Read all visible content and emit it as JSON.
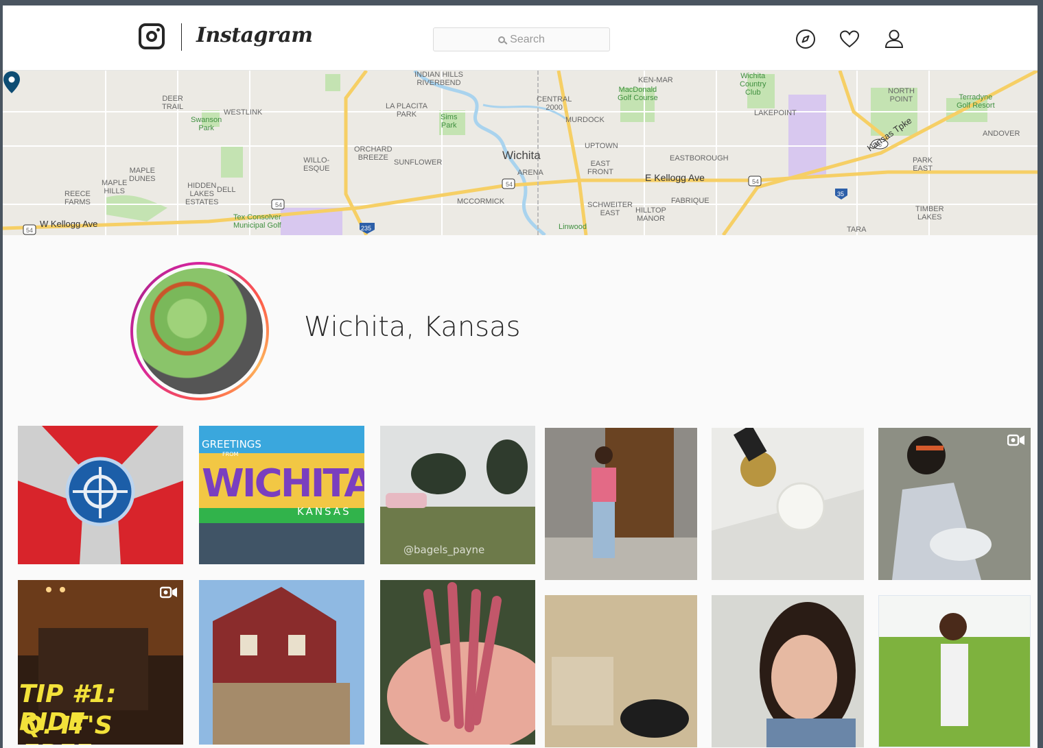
{
  "header": {
    "wordmark": "Instagram",
    "search_placeholder": "Search"
  },
  "map": {
    "city_label": "Wichita",
    "road_east": "E Kellogg Ave",
    "road_west": "W Kellogg Ave",
    "turnpike": "Kansas Tpke",
    "labels": {
      "riverbend": "INDIAN HILLS\nRIVERBEND",
      "deer_trail": "DEER\nTRAIL",
      "westlink": "WESTLINK",
      "swanson": "Swanson\nPark",
      "la_placita": "LA PLACITA\nPARK",
      "sims": "Sims\nPark",
      "central": "CENTRAL\n2000",
      "murdock": "MURDOCK",
      "ken_mar": "KEN-MAR",
      "macdonald": "MacDonald\nGolf Course",
      "wichita_cc": "Wichita\nCountry\nClub",
      "lakepoint": "LAKEPOINT",
      "north_point": "NORTH\nPOINT",
      "terradyne": "Terradyne\nGolf Resort",
      "andover": "ANDOVER",
      "orchard": "ORCHARD\nBREEZE",
      "sunflower": "SUNFLOWER",
      "uptown": "UPTOWN",
      "eastborough": "EASTBOROUGH",
      "willo": "WILLO-\nESQUE",
      "maple_dunes": "MAPLE\nDUNES",
      "maple_hills": "MAPLE\nHILLS",
      "reece": "REECE\nFARMS",
      "hidden_lakes": "HIDDEN\nLAKES\nESTATES",
      "dell": "DELL",
      "arena": "ARENA",
      "east_front": "EAST\nFRONT",
      "park_east": "PARK\nEAST",
      "mccormick": "MCCORMICK",
      "schweiter": "SCHWEITER\nEAST",
      "hilltop": "HILLTOP\nMANOR",
      "fabrique": "FABRIQUE",
      "timber": "TIMBER\nLAKES",
      "tara": "TARA",
      "linwood": "Linwood",
      "tex": "Tex Consolver\nMunicipal Golf",
      "shield_54": "54",
      "shield_96": "96",
      "shield_35": "35",
      "shield_235": "235"
    }
  },
  "location": {
    "title": "Wichita, Kansas"
  },
  "posts": {
    "greeting_top": "GREETINGS",
    "greeting_from": "FROM",
    "greeting_city": "WICHITA",
    "greeting_state": "KANSAS",
    "watermark": "@bagels_payne",
    "tip_line1": "TIP #1: RIDE",
    "tip_line2": "Q. IT'S FREE"
  },
  "colors": {
    "accent": "#d6249f",
    "pin": "#0e4d73",
    "highway": "#f6cf65"
  }
}
